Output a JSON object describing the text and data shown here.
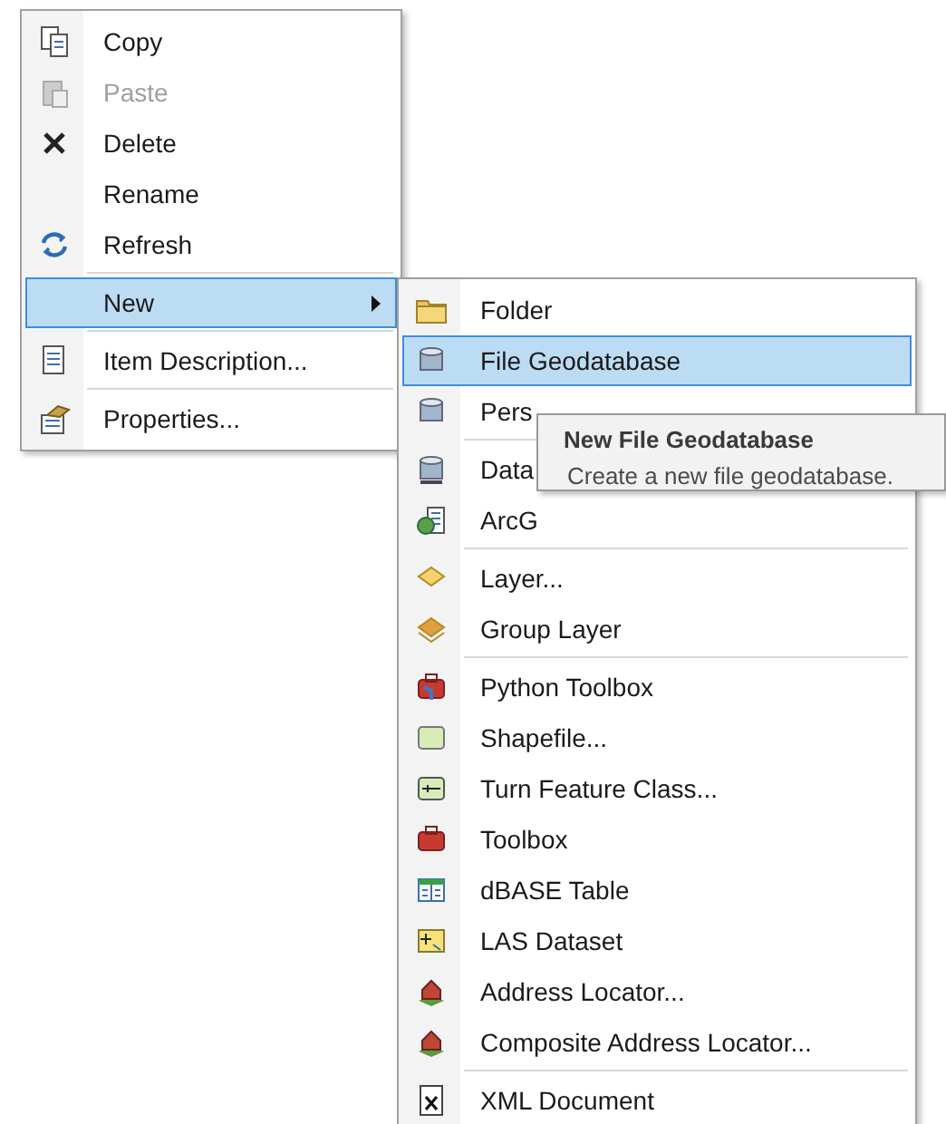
{
  "context_menu": {
    "groups": [
      [
        {
          "label": "Copy",
          "disabled": false,
          "selected": false,
          "submenu": false
        },
        {
          "label": "Paste",
          "disabled": true,
          "selected": false,
          "submenu": false
        },
        {
          "label": "Delete",
          "disabled": false,
          "selected": false,
          "submenu": false
        },
        {
          "label": "Rename",
          "disabled": false,
          "selected": false,
          "submenu": false
        },
        {
          "label": "Refresh",
          "disabled": false,
          "selected": false,
          "submenu": false
        }
      ],
      [
        {
          "label": "New",
          "disabled": false,
          "selected": true,
          "submenu": true
        }
      ],
      [
        {
          "label": "Item Description...",
          "disabled": false,
          "selected": false,
          "submenu": false
        }
      ],
      [
        {
          "label": "Properties...",
          "disabled": false,
          "selected": false,
          "submenu": false
        }
      ]
    ]
  },
  "submenu": {
    "groups": [
      [
        {
          "label": "Folder",
          "selected": false
        },
        {
          "label": "File Geodatabase",
          "selected": true
        },
        {
          "label": "Pers",
          "selected": false
        }
      ],
      [
        {
          "label": "Data",
          "selected": false
        },
        {
          "label": "ArcG",
          "selected": false
        }
      ],
      [
        {
          "label": "Layer...",
          "selected": false
        },
        {
          "label": "Group Layer",
          "selected": false
        }
      ],
      [
        {
          "label": "Python Toolbox",
          "selected": false
        },
        {
          "label": "Shapefile...",
          "selected": false
        },
        {
          "label": "Turn Feature Class...",
          "selected": false
        },
        {
          "label": "Toolbox",
          "selected": false
        },
        {
          "label": "dBASE Table",
          "selected": false
        },
        {
          "label": "LAS Dataset",
          "selected": false
        },
        {
          "label": "Address Locator...",
          "selected": false
        },
        {
          "label": "Composite Address Locator...",
          "selected": false
        }
      ],
      [
        {
          "label": "XML Document",
          "selected": false
        }
      ]
    ]
  },
  "tooltip": {
    "title": "New File Geodatabase",
    "text": "Create a new file geodatabase."
  }
}
